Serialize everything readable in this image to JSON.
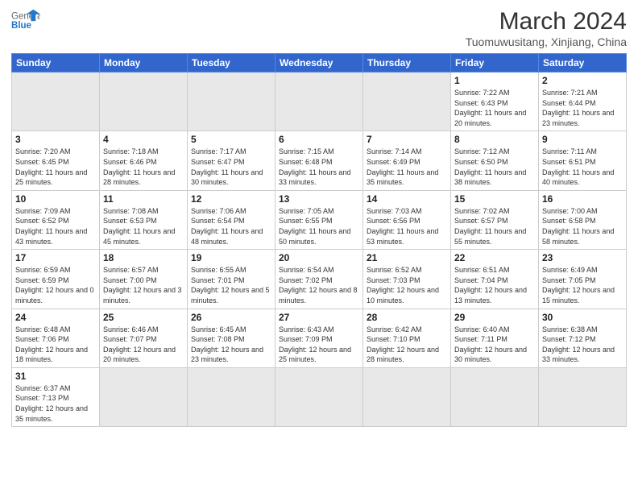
{
  "logo": {
    "text_general": "General",
    "text_blue": "Blue"
  },
  "title": {
    "month_year": "March 2024",
    "location": "Tuomuwusitang, Xinjiang, China"
  },
  "weekdays": [
    "Sunday",
    "Monday",
    "Tuesday",
    "Wednesday",
    "Thursday",
    "Friday",
    "Saturday"
  ],
  "weeks": [
    [
      {
        "day": "",
        "empty": true
      },
      {
        "day": "",
        "empty": true
      },
      {
        "day": "",
        "empty": true
      },
      {
        "day": "",
        "empty": true
      },
      {
        "day": "",
        "empty": true
      },
      {
        "day": "1",
        "sunrise": "7:22 AM",
        "sunset": "6:43 PM",
        "daylight": "11 hours and 20 minutes."
      },
      {
        "day": "2",
        "sunrise": "7:21 AM",
        "sunset": "6:44 PM",
        "daylight": "11 hours and 23 minutes."
      }
    ],
    [
      {
        "day": "3",
        "sunrise": "7:20 AM",
        "sunset": "6:45 PM",
        "daylight": "11 hours and 25 minutes."
      },
      {
        "day": "4",
        "sunrise": "7:18 AM",
        "sunset": "6:46 PM",
        "daylight": "11 hours and 28 minutes."
      },
      {
        "day": "5",
        "sunrise": "7:17 AM",
        "sunset": "6:47 PM",
        "daylight": "11 hours and 30 minutes."
      },
      {
        "day": "6",
        "sunrise": "7:15 AM",
        "sunset": "6:48 PM",
        "daylight": "11 hours and 33 minutes."
      },
      {
        "day": "7",
        "sunrise": "7:14 AM",
        "sunset": "6:49 PM",
        "daylight": "11 hours and 35 minutes."
      },
      {
        "day": "8",
        "sunrise": "7:12 AM",
        "sunset": "6:50 PM",
        "daylight": "11 hours and 38 minutes."
      },
      {
        "day": "9",
        "sunrise": "7:11 AM",
        "sunset": "6:51 PM",
        "daylight": "11 hours and 40 minutes."
      }
    ],
    [
      {
        "day": "10",
        "sunrise": "7:09 AM",
        "sunset": "6:52 PM",
        "daylight": "11 hours and 43 minutes."
      },
      {
        "day": "11",
        "sunrise": "7:08 AM",
        "sunset": "6:53 PM",
        "daylight": "11 hours and 45 minutes."
      },
      {
        "day": "12",
        "sunrise": "7:06 AM",
        "sunset": "6:54 PM",
        "daylight": "11 hours and 48 minutes."
      },
      {
        "day": "13",
        "sunrise": "7:05 AM",
        "sunset": "6:55 PM",
        "daylight": "11 hours and 50 minutes."
      },
      {
        "day": "14",
        "sunrise": "7:03 AM",
        "sunset": "6:56 PM",
        "daylight": "11 hours and 53 minutes."
      },
      {
        "day": "15",
        "sunrise": "7:02 AM",
        "sunset": "6:57 PM",
        "daylight": "11 hours and 55 minutes."
      },
      {
        "day": "16",
        "sunrise": "7:00 AM",
        "sunset": "6:58 PM",
        "daylight": "11 hours and 58 minutes."
      }
    ],
    [
      {
        "day": "17",
        "sunrise": "6:59 AM",
        "sunset": "6:59 PM",
        "daylight": "12 hours and 0 minutes."
      },
      {
        "day": "18",
        "sunrise": "6:57 AM",
        "sunset": "7:00 PM",
        "daylight": "12 hours and 3 minutes."
      },
      {
        "day": "19",
        "sunrise": "6:55 AM",
        "sunset": "7:01 PM",
        "daylight": "12 hours and 5 minutes."
      },
      {
        "day": "20",
        "sunrise": "6:54 AM",
        "sunset": "7:02 PM",
        "daylight": "12 hours and 8 minutes."
      },
      {
        "day": "21",
        "sunrise": "6:52 AM",
        "sunset": "7:03 PM",
        "daylight": "12 hours and 10 minutes."
      },
      {
        "day": "22",
        "sunrise": "6:51 AM",
        "sunset": "7:04 PM",
        "daylight": "12 hours and 13 minutes."
      },
      {
        "day": "23",
        "sunrise": "6:49 AM",
        "sunset": "7:05 PM",
        "daylight": "12 hours and 15 minutes."
      }
    ],
    [
      {
        "day": "24",
        "sunrise": "6:48 AM",
        "sunset": "7:06 PM",
        "daylight": "12 hours and 18 minutes."
      },
      {
        "day": "25",
        "sunrise": "6:46 AM",
        "sunset": "7:07 PM",
        "daylight": "12 hours and 20 minutes."
      },
      {
        "day": "26",
        "sunrise": "6:45 AM",
        "sunset": "7:08 PM",
        "daylight": "12 hours and 23 minutes."
      },
      {
        "day": "27",
        "sunrise": "6:43 AM",
        "sunset": "7:09 PM",
        "daylight": "12 hours and 25 minutes."
      },
      {
        "day": "28",
        "sunrise": "6:42 AM",
        "sunset": "7:10 PM",
        "daylight": "12 hours and 28 minutes."
      },
      {
        "day": "29",
        "sunrise": "6:40 AM",
        "sunset": "7:11 PM",
        "daylight": "12 hours and 30 minutes."
      },
      {
        "day": "30",
        "sunrise": "6:38 AM",
        "sunset": "7:12 PM",
        "daylight": "12 hours and 33 minutes."
      }
    ],
    [
      {
        "day": "31",
        "sunrise": "6:37 AM",
        "sunset": "7:13 PM",
        "daylight": "12 hours and 35 minutes."
      },
      {
        "day": "",
        "empty": true
      },
      {
        "day": "",
        "empty": true
      },
      {
        "day": "",
        "empty": true
      },
      {
        "day": "",
        "empty": true
      },
      {
        "day": "",
        "empty": true
      },
      {
        "day": "",
        "empty": true
      }
    ]
  ]
}
